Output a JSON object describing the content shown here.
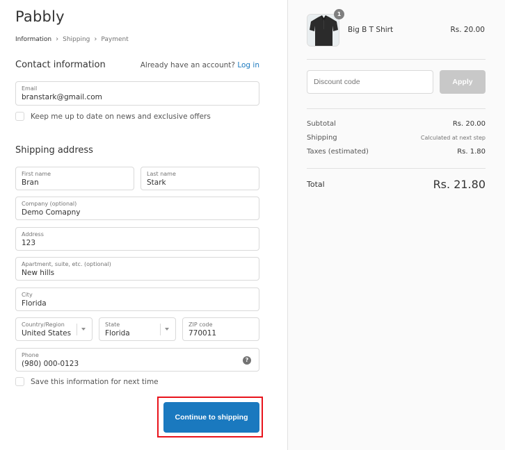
{
  "brand": {
    "logo": "Pabbly"
  },
  "breadcrumb": [
    {
      "label": "Information",
      "current": true
    },
    {
      "label": "Shipping",
      "current": false
    },
    {
      "label": "Payment",
      "current": false
    }
  ],
  "contact": {
    "title": "Contact information",
    "account_prompt": "Already have an account?",
    "login_link": "Log in",
    "email": {
      "label": "Email",
      "value": "branstark@gmail.com"
    },
    "newsletter": {
      "label": "Keep me up to date on news and exclusive offers",
      "checked": false
    }
  },
  "shipping": {
    "title": "Shipping address",
    "first_name": {
      "label": "First name",
      "value": "Bran"
    },
    "last_name": {
      "label": "Last name",
      "value": "Stark"
    },
    "company": {
      "label": "Company (optional)",
      "value": "Demo Comapny"
    },
    "address": {
      "label": "Address",
      "value": "123"
    },
    "apartment": {
      "label": "Apartment, suite, etc. (optional)",
      "value": "New hills"
    },
    "city": {
      "label": "City",
      "value": "Florida"
    },
    "country": {
      "label": "Country/Region",
      "value": "United States"
    },
    "state": {
      "label": "State",
      "value": "Florida"
    },
    "zip": {
      "label": "ZIP code",
      "value": "770011"
    },
    "phone": {
      "label": "Phone",
      "value": "(980) 000-0123",
      "help_icon": "question-circle-icon"
    },
    "save_info": {
      "label": "Save this information for next time",
      "checked": false
    }
  },
  "actions": {
    "continue_label": "Continue to shipping",
    "highlight_color": "#e8131b",
    "primary_color": "#1a79bf"
  },
  "order": {
    "item": {
      "name": "Big B T Shirt",
      "price": "Rs. 20.00",
      "quantity": "1"
    },
    "discount": {
      "placeholder": "Discount code",
      "apply_label": "Apply"
    },
    "summary": [
      {
        "label": "Subtotal",
        "value": "Rs. 20.00"
      },
      {
        "label": "Shipping",
        "value": "Calculated at next step"
      },
      {
        "label": "Taxes (estimated)",
        "value": "Rs. 1.80"
      }
    ],
    "total": {
      "label": "Total",
      "value": "Rs. 21.80"
    }
  }
}
